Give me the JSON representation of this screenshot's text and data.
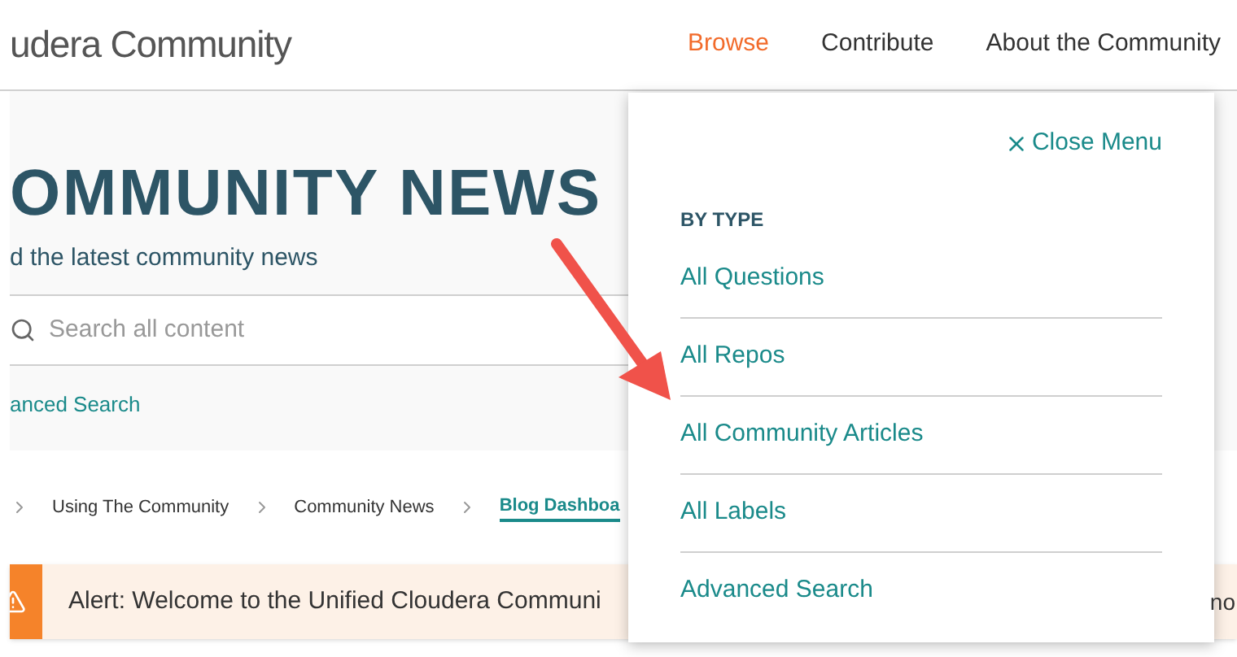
{
  "header": {
    "site_name": "udera Community"
  },
  "nav": [
    {
      "label": "Browse",
      "selected": true
    },
    {
      "label": "Contribute",
      "selected": false
    },
    {
      "label": "About the Community",
      "selected": false
    }
  ],
  "hero": {
    "title": "OMMUNITY NEWS",
    "subtitle": "d the latest community news",
    "search": {
      "placeholder": "Search all content"
    },
    "advanced_search": "anced Search"
  },
  "breadcrumb": [
    {
      "label": "Using The Community",
      "current": false
    },
    {
      "label": "Community News",
      "current": false
    },
    {
      "label": "Blog Dashboa",
      "current": true
    }
  ],
  "alert": {
    "text": "Alert: Welcome to the Unified Cloudera Communi",
    "tail": "no"
  },
  "menu": {
    "close_label": "Close Menu",
    "heading": "BY TYPE",
    "items": [
      "All Questions",
      "All Repos",
      "All Community Articles",
      "All Labels",
      "Advanced Search"
    ]
  }
}
